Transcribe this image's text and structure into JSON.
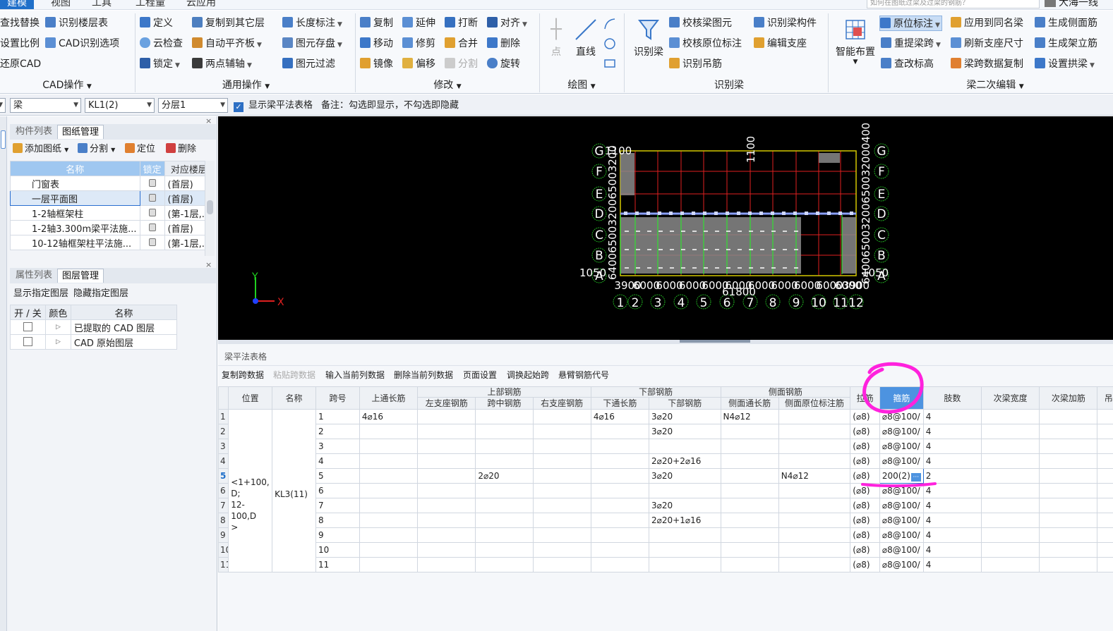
{
  "menu": {
    "items": [
      "建模",
      "视图",
      "工具",
      "工程量",
      "云应用"
    ],
    "active": 0,
    "search_placeholder": "如何在图纸过梁及过梁的钢筋？",
    "user": "大海一线"
  },
  "ribbon": {
    "cad_ops": {
      "items": [
        "查找替换",
        "设置比例",
        "还原CAD",
        "识别楼层表",
        "CAD识别选项"
      ],
      "group": "CAD操作"
    },
    "common_ops": {
      "items": [
        "定义",
        "云检查",
        "锁定",
        "复制到其它层",
        "自动平齐板",
        "两点辅轴",
        "长度标注",
        "图元存盘",
        "图元过滤"
      ],
      "group": "通用操作"
    },
    "modify": {
      "items": [
        "复制",
        "移动",
        "镜像",
        "延伸",
        "修剪",
        "偏移",
        "打断",
        "合并",
        "分割",
        "对齐",
        "删除",
        "旋转"
      ],
      "group": "修改"
    },
    "draw": {
      "items": [
        "点",
        "直线"
      ],
      "group": "绘图"
    },
    "recognize_beam": {
      "items": [
        "识别梁",
        "校核梁图元",
        "校核原位标注",
        "识别吊筋",
        "识别梁构件",
        "编辑支座"
      ],
      "group": "识别梁"
    },
    "beam_edit": {
      "items": [
        "智能布置",
        "原位标注",
        "重提梁跨",
        "查改标高",
        "应用到同名梁",
        "刷新支座尺寸",
        "梁跨数据复制",
        "生成侧面筋",
        "生成架立筋",
        "设置拱梁"
      ],
      "group": "梁二次编辑"
    }
  },
  "toolbar2": {
    "combo_type": "梁",
    "combo_member": "KL1(2)",
    "combo_layer": "分层1",
    "show_table_label": "显示梁平法表格",
    "note": "备注：勾选即显示，不勾选即隐藏"
  },
  "drawings_panel": {
    "tabs": [
      "构件列表",
      "图纸管理"
    ],
    "active_tab": 1,
    "actions": [
      "添加图纸",
      "分割",
      "定位",
      "删除"
    ],
    "columns": [
      "名称",
      "锁定",
      "对应楼层"
    ],
    "rows": [
      {
        "name": "门窗表",
        "floor": "(首层)"
      },
      {
        "name": "一层平面图",
        "floor": "(首层)"
      },
      {
        "name": "1-2轴框架柱",
        "floor": "(第-1层,..."
      },
      {
        "name": "1-2轴3.300m梁平法施...",
        "floor": "(首层)"
      },
      {
        "name": "10-12轴框架柱平法施...",
        "floor": "(第-1层,..."
      }
    ],
    "selected_row": 1
  },
  "layers_panel": {
    "tabs": [
      "属性列表",
      "图层管理"
    ],
    "active_tab": 1,
    "actions": [
      "显示指定图层",
      "隐藏指定图层"
    ],
    "columns": [
      "开 / 关",
      "颜色",
      "名称"
    ],
    "rows": [
      {
        "name": "已提取的 CAD 图层"
      },
      {
        "name": "CAD 原始图层"
      }
    ]
  },
  "canvas": {
    "row_axes": [
      "G",
      "F",
      "E",
      "D",
      "C",
      "B",
      "A"
    ],
    "col_axes": [
      "1",
      "2",
      "3",
      "4",
      "5",
      "6",
      "7",
      "8",
      "9",
      "10",
      "11",
      "12"
    ],
    "dims": {
      "top_left": "1100",
      "top_mid": "1100",
      "left_mid": "1050",
      "right_mid": "1050",
      "total": "61800",
      "spans": [
        "3900",
        "6000",
        "6000",
        "6000",
        "6000",
        "6000",
        "6000",
        "6000",
        "6000",
        "6000",
        "6000",
        "3900"
      ],
      "vertical_left": "64006500320065003200",
      "vertical_right": "640065003200650032000400"
    },
    "axis_x": "X",
    "axis_y": "Y"
  },
  "beam_table": {
    "title": "梁平法表格",
    "actions": [
      "复制跨数据",
      "粘贴跨数据",
      "输入当前列数据",
      "删除当前列数据",
      "页面设置",
      "调换起始跨",
      "悬臂钢筋代号"
    ],
    "disabled_actions": [
      1
    ],
    "group_headers": {
      "top": "上部钢筋",
      "bottom": "下部钢筋",
      "side": "侧面钢筋"
    },
    "headers": {
      "pos": "位置",
      "name": "名称",
      "span": "跨号",
      "top_through": "上通长筋",
      "left_seat": "左支座钢筋",
      "mid_span": "跨中钢筋",
      "right_seat": "右支座钢筋",
      "bottom_through": "下通长筋",
      "bottom_bar": "下部钢筋",
      "side_through": "侧面通长筋",
      "side_in_place": "侧面原位标注筋",
      "tie": "拉筋",
      "stirrup": "箍筋",
      "legs": "肢数",
      "sec_width": "次梁宽度",
      "sec_add": "次梁加筋",
      "hanger": "吊"
    },
    "position_value": "<1+100,\nD;\n12-100,D\n>",
    "name_value": "KL3(11)",
    "current_row": 5,
    "rows": [
      {
        "n": "1",
        "span": "1",
        "top_through": "4⌀16",
        "mid": "",
        "bottom_through": "4⌀16",
        "bottom": "3⌀20",
        "side_through": "N4⌀12",
        "side_place": "",
        "tie": "(⌀8)",
        "stirrup": "⌀8@100/",
        "legs": "4"
      },
      {
        "n": "2",
        "span": "2",
        "top_through": "",
        "mid": "",
        "bottom_through": "",
        "bottom": "3⌀20",
        "side_through": "",
        "side_place": "",
        "tie": "(⌀8)",
        "stirrup": "⌀8@100/",
        "legs": "4"
      },
      {
        "n": "3",
        "span": "3",
        "top_through": "",
        "mid": "",
        "bottom_through": "",
        "bottom": "",
        "side_through": "",
        "side_place": "",
        "tie": "(⌀8)",
        "stirrup": "⌀8@100/",
        "legs": "4"
      },
      {
        "n": "4",
        "span": "4",
        "top_through": "",
        "mid": "",
        "bottom_through": "",
        "bottom": "2⌀20+2⌀16",
        "side_through": "",
        "side_place": "",
        "tie": "(⌀8)",
        "stirrup": "⌀8@100/",
        "legs": "4"
      },
      {
        "n": "5",
        "span": "5",
        "top_through": "",
        "mid": "2⌀20",
        "bottom_through": "",
        "bottom": "3⌀20",
        "side_through": "",
        "side_place": "N4⌀12",
        "tie": "(⌀8)",
        "stirrup": "200(2)",
        "legs": "2"
      },
      {
        "n": "6",
        "span": "6",
        "top_through": "",
        "mid": "",
        "bottom_through": "",
        "bottom": "",
        "side_through": "",
        "side_place": "",
        "tie": "(⌀8)",
        "stirrup": "⌀8@100/",
        "legs": "4"
      },
      {
        "n": "7",
        "span": "7",
        "top_through": "",
        "mid": "",
        "bottom_through": "",
        "bottom": "3⌀20",
        "side_through": "",
        "side_place": "",
        "tie": "(⌀8)",
        "stirrup": "⌀8@100/",
        "legs": "4"
      },
      {
        "n": "8",
        "span": "8",
        "top_through": "",
        "mid": "",
        "bottom_through": "",
        "bottom": "2⌀20+1⌀16",
        "side_through": "",
        "side_place": "",
        "tie": "(⌀8)",
        "stirrup": "⌀8@100/",
        "legs": "4"
      },
      {
        "n": "9",
        "span": "9",
        "top_through": "",
        "mid": "",
        "bottom_through": "",
        "bottom": "",
        "side_through": "",
        "side_place": "",
        "tie": "(⌀8)",
        "stirrup": "⌀8@100/",
        "legs": "4"
      },
      {
        "n": "10",
        "span": "10",
        "top_through": "",
        "mid": "",
        "bottom_through": "",
        "bottom": "",
        "side_through": "",
        "side_place": "",
        "tie": "(⌀8)",
        "stirrup": "⌀8@100/",
        "legs": "4"
      },
      {
        "n": "11",
        "span": "11",
        "top_through": "",
        "mid": "",
        "bottom_through": "",
        "bottom": "",
        "side_through": "",
        "side_place": "",
        "tie": "(⌀8)",
        "stirrup": "⌀8@100/",
        "legs": "4"
      }
    ]
  },
  "colors": {
    "accent": "#1f6fc9",
    "highlight_header": "#4d93e0",
    "annotation": "#ff22dd",
    "canvas_bg": "#000000"
  }
}
